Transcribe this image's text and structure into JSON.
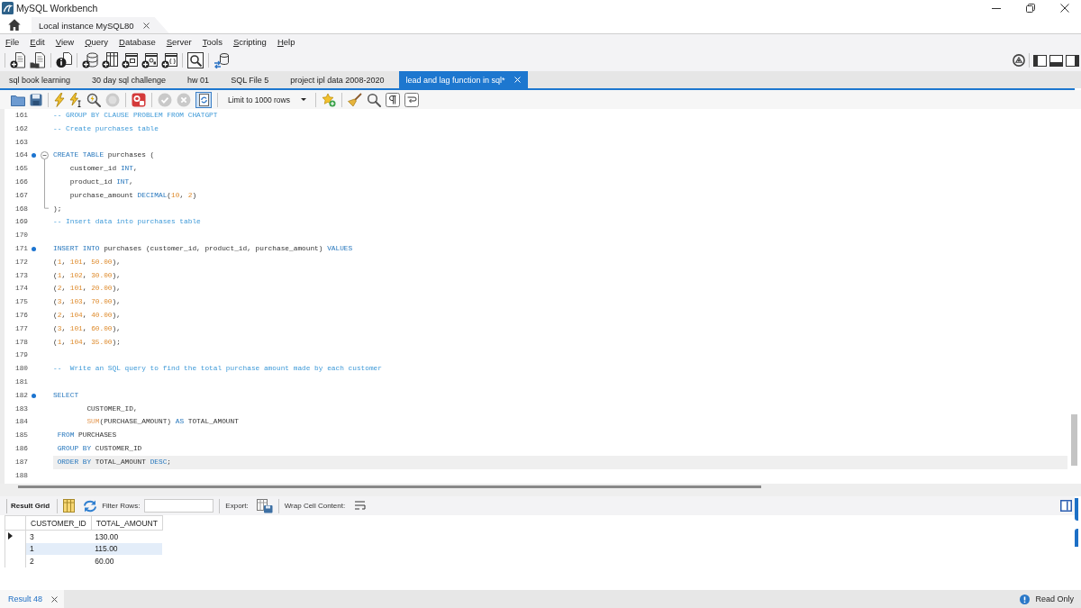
{
  "window": {
    "title": "MySQL Workbench"
  },
  "connection_tabs": [
    {
      "label": "Local instance MySQL80",
      "selected": true
    }
  ],
  "menu": [
    "File",
    "Edit",
    "View",
    "Query",
    "Database",
    "Server",
    "Tools",
    "Scripting",
    "Help"
  ],
  "panel_toggles": [
    {
      "on": true
    },
    {
      "on": true
    },
    {
      "on": true
    }
  ],
  "query_tabs": [
    {
      "label": "sql book learning",
      "selected": false
    },
    {
      "label": "30 day sql challenge",
      "selected": false
    },
    {
      "label": "hw 01",
      "selected": false
    },
    {
      "label": "SQL File 5",
      "selected": false
    },
    {
      "label": "project ipl data 2008-2020",
      "selected": false
    },
    {
      "label": "lead and lag function in sql*",
      "selected": true
    }
  ],
  "editor_toolbar": {
    "stop_disabled": true,
    "commit_disabled": true,
    "rollback_disabled": true,
    "autocommit_on": true,
    "row_limit": "Limit to 1000 rows"
  },
  "editor": {
    "lines": [
      {
        "number": "161",
        "statement": false,
        "current": false,
        "tokens": [
          {
            "kind": "comment",
            "text": "-- GROUP BY CLAUSE PROBLEM FROM CHATGPT"
          }
        ]
      },
      {
        "number": "162",
        "statement": false,
        "current": false,
        "tokens": [
          {
            "kind": "comment",
            "text": "-- Create purchases table"
          }
        ]
      },
      {
        "number": "163",
        "statement": false,
        "current": false
      },
      {
        "number": "164",
        "statement": true,
        "current": false,
        "expanded": true,
        "tokens": [
          {
            "kind": "keyword",
            "text": "CREATE TABLE"
          },
          {
            "kind": "plain",
            "text": " purchases ("
          }
        ],
        "children": [
          {
            "number": "165",
            "statement": false,
            "current": false,
            "tokens": [
              {
                "kind": "plain",
                "text": "    customer_id "
              },
              {
                "kind": "keyword",
                "text": "INT"
              },
              {
                "kind": "plain",
                "text": ","
              }
            ]
          },
          {
            "number": "166",
            "statement": false,
            "current": false,
            "tokens": [
              {
                "kind": "plain",
                "text": "    product_id "
              },
              {
                "kind": "keyword",
                "text": "INT"
              },
              {
                "kind": "plain",
                "text": ","
              }
            ]
          },
          {
            "number": "167",
            "statement": false,
            "current": false,
            "tokens": [
              {
                "kind": "plain",
                "text": "    purchase_amount "
              },
              {
                "kind": "keyword",
                "text": "DECIMAL"
              },
              {
                "kind": "plain",
                "text": "("
              },
              {
                "kind": "number",
                "text": "10"
              },
              {
                "kind": "plain",
                "text": ", "
              },
              {
                "kind": "number",
                "text": "2"
              },
              {
                "kind": "plain",
                "text": ")"
              }
            ]
          },
          {
            "number": "168",
            "statement": false,
            "current": false,
            "tokens": [
              {
                "kind": "plain",
                "text": ");"
              }
            ]
          }
        ]
      },
      {
        "number": "169",
        "statement": false,
        "current": false,
        "tokens": [
          {
            "kind": "comment",
            "text": "-- Insert data into purchases table"
          }
        ]
      },
      {
        "number": "170",
        "statement": false,
        "current": false
      },
      {
        "number": "171",
        "statement": true,
        "current": false,
        "tokens": [
          {
            "kind": "keyword",
            "text": "INSERT INTO"
          },
          {
            "kind": "plain",
            "text": " purchases (customer_id, product_id, purchase_amount) "
          },
          {
            "kind": "keyword",
            "text": "VALUES"
          }
        ]
      },
      {
        "number": "172",
        "statement": false,
        "current": false,
        "tokens": [
          {
            "kind": "plain",
            "text": "("
          },
          {
            "kind": "number",
            "text": "1"
          },
          {
            "kind": "plain",
            "text": ", "
          },
          {
            "kind": "number",
            "text": "101"
          },
          {
            "kind": "plain",
            "text": ", "
          },
          {
            "kind": "number",
            "text": "50.00"
          },
          {
            "kind": "plain",
            "text": "),"
          }
        ]
      },
      {
        "number": "173",
        "statement": false,
        "current": false,
        "tokens": [
          {
            "kind": "plain",
            "text": "("
          },
          {
            "kind": "number",
            "text": "1"
          },
          {
            "kind": "plain",
            "text": ", "
          },
          {
            "kind": "number",
            "text": "102"
          },
          {
            "kind": "plain",
            "text": ", "
          },
          {
            "kind": "number",
            "text": "30.00"
          },
          {
            "kind": "plain",
            "text": "),"
          }
        ]
      },
      {
        "number": "174",
        "statement": false,
        "current": false,
        "tokens": [
          {
            "kind": "plain",
            "text": "("
          },
          {
            "kind": "number",
            "text": "2"
          },
          {
            "kind": "plain",
            "text": ", "
          },
          {
            "kind": "number",
            "text": "101"
          },
          {
            "kind": "plain",
            "text": ", "
          },
          {
            "kind": "number",
            "text": "20.00"
          },
          {
            "kind": "plain",
            "text": "),"
          }
        ]
      },
      {
        "number": "175",
        "statement": false,
        "current": false,
        "tokens": [
          {
            "kind": "plain",
            "text": "("
          },
          {
            "kind": "number",
            "text": "3"
          },
          {
            "kind": "plain",
            "text": ", "
          },
          {
            "kind": "number",
            "text": "103"
          },
          {
            "kind": "plain",
            "text": ", "
          },
          {
            "kind": "number",
            "text": "70.00"
          },
          {
            "kind": "plain",
            "text": "),"
          }
        ]
      },
      {
        "number": "176",
        "statement": false,
        "current": false,
        "tokens": [
          {
            "kind": "plain",
            "text": "("
          },
          {
            "kind": "number",
            "text": "2"
          },
          {
            "kind": "plain",
            "text": ", "
          },
          {
            "kind": "number",
            "text": "104"
          },
          {
            "kind": "plain",
            "text": ", "
          },
          {
            "kind": "number",
            "text": "40.00"
          },
          {
            "kind": "plain",
            "text": "),"
          }
        ]
      },
      {
        "number": "177",
        "statement": false,
        "current": false,
        "tokens": [
          {
            "kind": "plain",
            "text": "("
          },
          {
            "kind": "number",
            "text": "3"
          },
          {
            "kind": "plain",
            "text": ", "
          },
          {
            "kind": "number",
            "text": "101"
          },
          {
            "kind": "plain",
            "text": ", "
          },
          {
            "kind": "number",
            "text": "60.00"
          },
          {
            "kind": "plain",
            "text": "),"
          }
        ]
      },
      {
        "number": "178",
        "statement": false,
        "current": false,
        "tokens": [
          {
            "kind": "plain",
            "text": "("
          },
          {
            "kind": "number",
            "text": "1"
          },
          {
            "kind": "plain",
            "text": ", "
          },
          {
            "kind": "number",
            "text": "104"
          },
          {
            "kind": "plain",
            "text": ", "
          },
          {
            "kind": "number",
            "text": "35.00"
          },
          {
            "kind": "plain",
            "text": ");"
          }
        ]
      },
      {
        "number": "179",
        "statement": false,
        "current": false
      },
      {
        "number": "180",
        "statement": false,
        "current": false,
        "tokens": [
          {
            "kind": "comment",
            "text": "--  Write an SQL query to find the total purchase amount made by each customer"
          }
        ]
      },
      {
        "number": "181",
        "statement": false,
        "current": false
      },
      {
        "number": "182",
        "statement": true,
        "current": false,
        "tokens": [
          {
            "kind": "keyword",
            "text": "SELECT"
          }
        ]
      },
      {
        "number": "183",
        "statement": false,
        "current": false,
        "tokens": [
          {
            "kind": "plain",
            "text": "        CUSTOMER_ID,"
          }
        ]
      },
      {
        "number": "184",
        "statement": false,
        "current": false,
        "tokens": [
          {
            "kind": "function",
            "text": "        SUM"
          },
          {
            "kind": "plain",
            "text": "(PURCHASE_AMOUNT) "
          },
          {
            "kind": "keyword",
            "text": "AS"
          },
          {
            "kind": "plain",
            "text": " TOTAL_AMOUNT"
          }
        ]
      },
      {
        "number": "185",
        "statement": false,
        "current": false,
        "tokens": [
          {
            "kind": "keyword",
            "text": " FROM"
          },
          {
            "kind": "plain",
            "text": " PURCHASES"
          }
        ]
      },
      {
        "number": "186",
        "statement": false,
        "current": false,
        "tokens": [
          {
            "kind": "keyword",
            "text": " GROUP BY"
          },
          {
            "kind": "plain",
            "text": " CUSTOMER_ID"
          }
        ]
      },
      {
        "number": "187",
        "statement": false,
        "current": true,
        "tokens": [
          {
            "kind": "keyword",
            "text": " ORDER BY"
          },
          {
            "kind": "plain",
            "text": " TOTAL_AMOUNT "
          },
          {
            "kind": "keyword",
            "text": "DESC"
          },
          {
            "kind": "plain",
            "text": ";"
          }
        ]
      },
      {
        "number": "188",
        "statement": false,
        "current": false
      }
    ]
  },
  "result": {
    "mode_button": "Result Grid",
    "filter_label": "Filter Rows:",
    "export_label": "Export:",
    "wrap_label": "Wrap Cell Content:",
    "columns": [
      "CUSTOMER_ID",
      "TOTAL_AMOUNT"
    ],
    "rows": [
      {
        "cells": [
          "3",
          "130.00"
        ],
        "current": true,
        "highlighted": false
      },
      {
        "cells": [
          "1",
          "115.00"
        ],
        "current": false,
        "highlighted": true
      },
      {
        "cells": [
          "2",
          "60.00"
        ],
        "current": false,
        "highlighted": false
      }
    ]
  },
  "result_tabs": [
    {
      "label": "Result 48",
      "selected": true
    }
  ],
  "status_bar": {
    "text": "Read Only"
  }
}
